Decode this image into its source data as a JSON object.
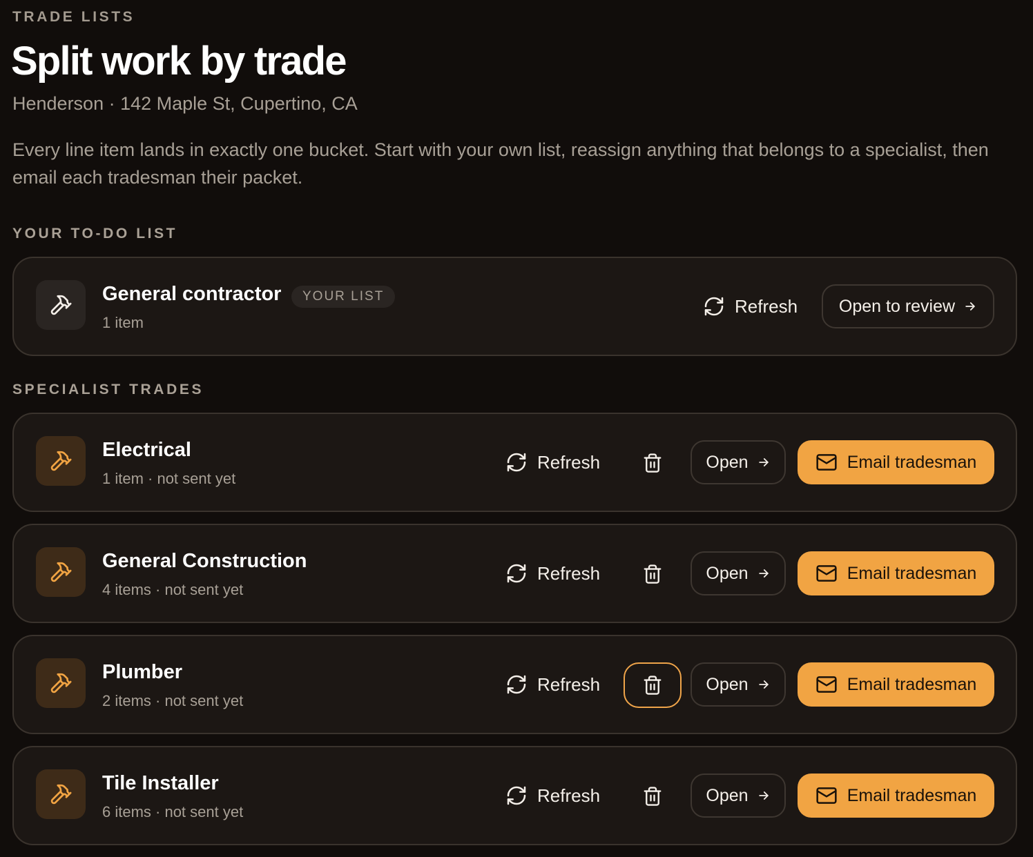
{
  "header": {
    "eyebrow": "TRADE LISTS",
    "title": "Split work by trade",
    "subtitle": "Henderson · 142 Maple St, Cupertino, CA",
    "description": "Every line item lands in exactly one bucket. Start with your own list, reassign anything that belongs to a specialist, then email each tradesman their packet."
  },
  "todo": {
    "section_label": "YOUR TO-DO LIST",
    "card": {
      "name": "General contractor",
      "badge": "YOUR LIST",
      "meta": "1 item",
      "icon": "hammer-icon",
      "refresh_label": "Refresh",
      "open_label": "Open to review"
    }
  },
  "specialists": {
    "section_label": "SPECIALIST TRADES",
    "refresh_label": "Refresh",
    "open_label": "Open",
    "email_label": "Email tradesman",
    "trades": [
      {
        "name": "Electrical",
        "meta": "1 item · not sent yet"
      },
      {
        "name": "General Construction",
        "meta": "4 items · not sent yet"
      },
      {
        "name": "Plumber",
        "meta": "2 items · not sent yet"
      },
      {
        "name": "Tile Installer",
        "meta": "6 items · not sent yet"
      }
    ]
  },
  "colors": {
    "background": "#110d0b",
    "card": "#1c1714",
    "accent": "#f1a443",
    "muted_text": "#a8a096"
  }
}
